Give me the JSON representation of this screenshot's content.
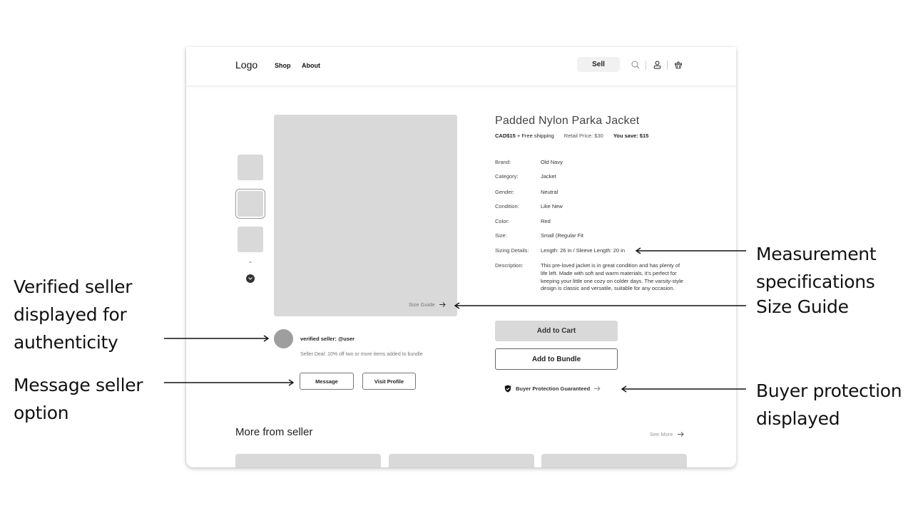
{
  "header": {
    "logo": "Logo",
    "nav": [
      "Shop",
      "About"
    ],
    "sell_label": "Sell",
    "icons": [
      "search-icon",
      "user-icon",
      "basket-icon"
    ]
  },
  "gallery": {
    "thumbnails": 3,
    "selected_index": 1,
    "size_guide_label": "Size Guide"
  },
  "product": {
    "title": "Padded Nylon Parka Jacket",
    "price": "CAD$15",
    "shipping": "+ Free shipping",
    "retail_price": "Retail Price: $30",
    "savings": "You save: $15",
    "specs": [
      {
        "label": "Brand:",
        "value": "Old Navy"
      },
      {
        "label": "Category:",
        "value": "Jacket"
      },
      {
        "label": "Gender:",
        "value": "Neutral"
      },
      {
        "label": "Condition:",
        "value": "Like New"
      },
      {
        "label": "Color:",
        "value": "Red"
      },
      {
        "label": "Size:",
        "value": "Small  (Regular Fit"
      },
      {
        "label": "Sizing Details:",
        "value": "Length: 26 in / Sleeve Length: 20 in"
      },
      {
        "label": "Description:",
        "value": "This pre-loved jacket is in great condition and has plenty of life left. Made with soft and warm materials, it's perfect for keeping your little one cozy on colder days. The varsity-style design is classic and versatile, suitable for any occasion."
      }
    ],
    "add_to_cart": "Add to Cart",
    "add_to_bundle": "Add to Bundle",
    "protection": "Buyer Protection Guaranteed"
  },
  "seller": {
    "name": "verified seller: @user",
    "deal": "Seller Deal: 10% off two or more items added to bundle",
    "message_label": "Message",
    "visit_label": "Visit Profile"
  },
  "more": {
    "title": "More from seller",
    "see_more": "See More",
    "cards": 3
  },
  "annotations": {
    "verified": "Verified seller displayed for authenticity",
    "message": "Message seller option",
    "measurement": "Measurement specifications",
    "size_guide": "Size Guide",
    "protection": "Buyer protection displayed"
  }
}
